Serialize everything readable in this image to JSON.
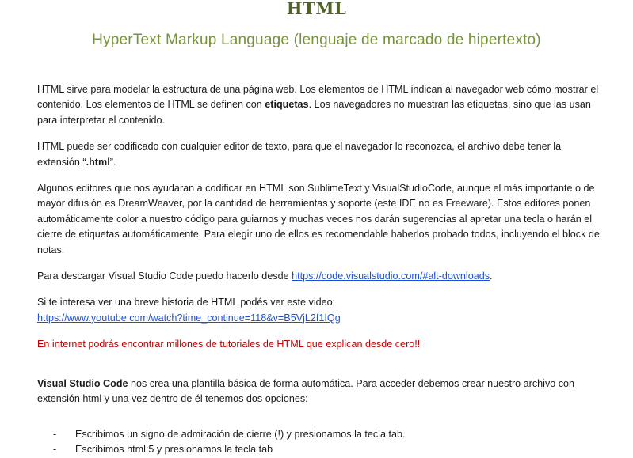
{
  "header": {
    "title": "HTML",
    "subtitle": "HyperText Markup Language (lenguaje de marcado de hipertexto)"
  },
  "paragraphs": {
    "p1": {
      "a": "HTML sirve para modelar la estructura de una página web. Los elementos de HTML indican al navegador web cómo mostrar el contenido. Los elementos de HTML se definen con ",
      "b": "etiquetas",
      "c": ". Los navegadores no muestran las etiquetas, sino que las usan para interpretar el contenido."
    },
    "p2": {
      "a": "HTML puede ser codificado con cualquier editor de texto, para que el navegador lo reconozca, el archivo debe tener la extensión “",
      "b": ".html",
      "c": "”."
    },
    "p3": "Algunos editores que nos ayudaran a codificar en HTML son SublimeText y VisualStudioCode, aunque el más importante o de mayor difusión es DreamWeaver,  por la cantidad de herramientas y soporte (este IDE no es Freeware). Estos editores ponen automáticamente color a nuestro código para guiarnos y muchas veces nos darán sugerencias al apretar una tecla o harán el cierre de etiquetas automáticamente. Para elegir uno de ellos es recomendable haberlos probado todos, incluyendo el block de notas.",
    "p4": {
      "a": "Para descargar Visual Studio Code puedo hacerlo desde ",
      "link": "https://code.visualstudio.com/#alt-downloads",
      "c": "."
    },
    "p5": {
      "a": "Si te interesa ver una breve historia de HTML podés ver este video:",
      "link": "https://www.youtube.com/watch?time_continue=118&v=B5VjL2f1IQg"
    },
    "p6": "En internet podrás encontrar millones de tutoriales de HTML que explican desde cero!!",
    "p7": {
      "b": "Visual Studio Code",
      "c": " nos crea una plantilla básica de forma automática. Para acceder debemos crear nuestro archivo con extensión html y una vez dentro de él tenemos dos opciones:"
    }
  },
  "list": {
    "bullet": "-",
    "items": [
      "Escribimos un signo de admiración de cierre (!) y presionamos la tecla tab.",
      "Escribimos html:5 y presionamos la tecla tab"
    ]
  },
  "colors": {
    "title": "#4f6228",
    "subtitle": "#76923c",
    "link": "#1f4fd8",
    "highlight": "#c00000"
  }
}
